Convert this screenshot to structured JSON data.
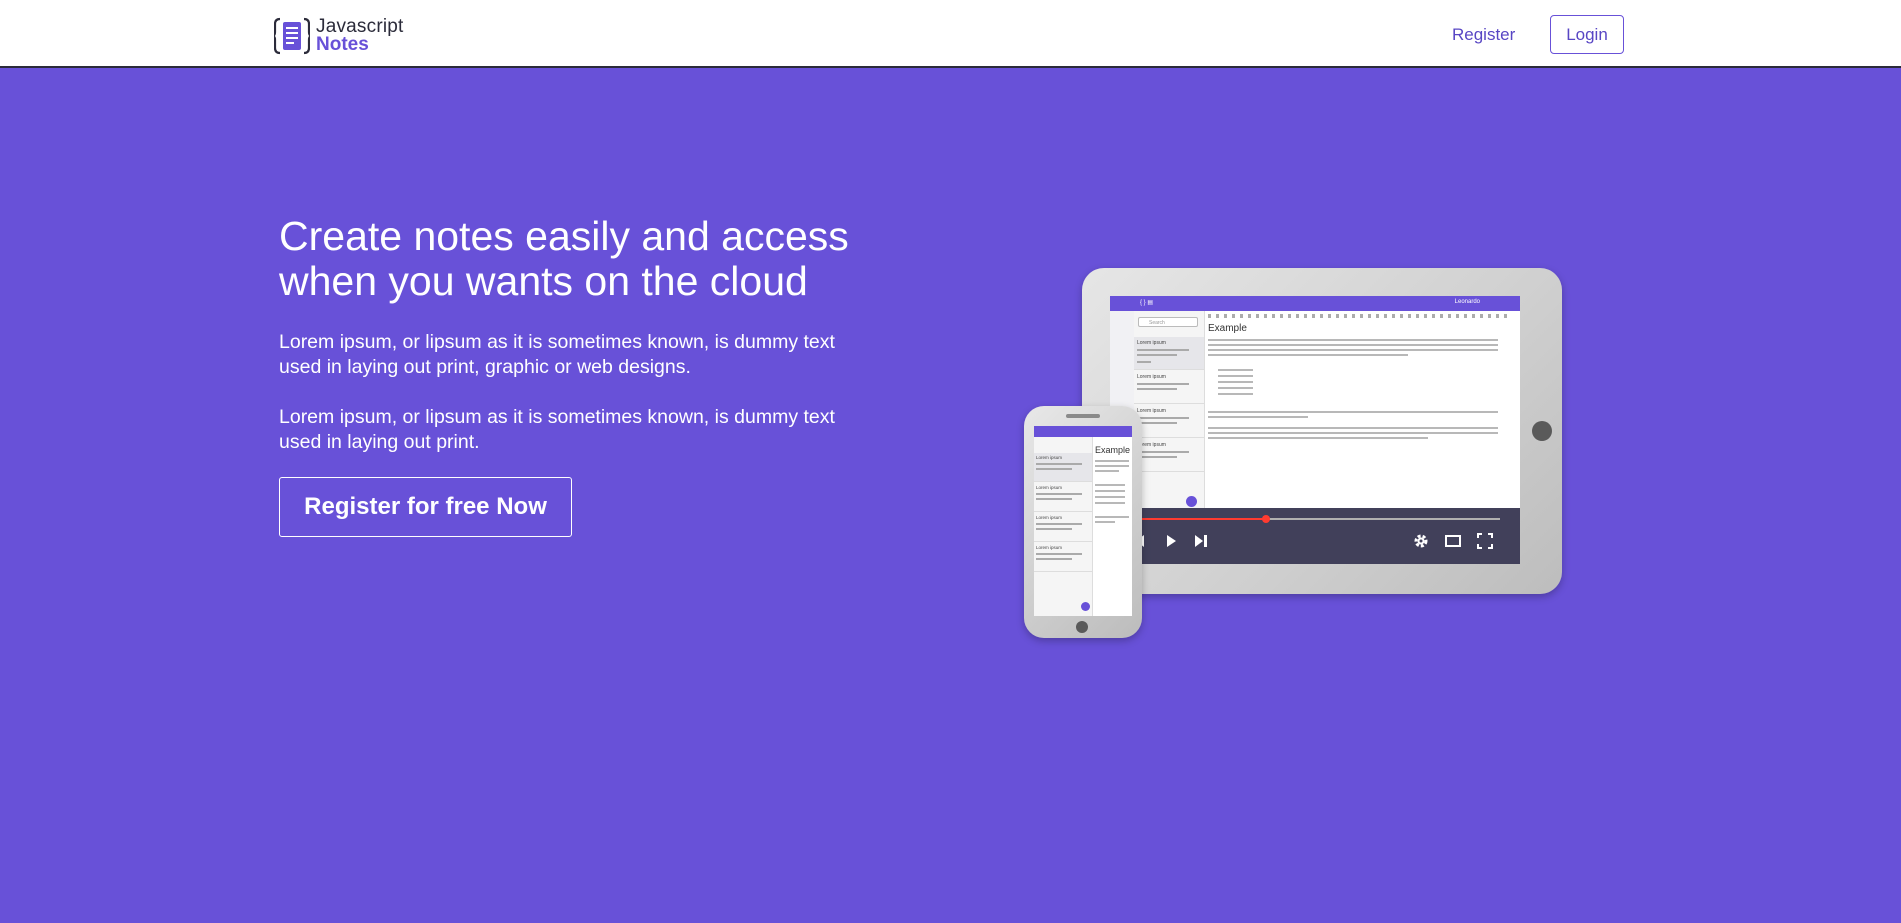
{
  "header": {
    "logo_line1": "Javascript",
    "logo_line2": "Notes",
    "register_label": "Register",
    "login_label": "Login"
  },
  "hero": {
    "title": "Create notes easily and access when you wants on the cloud",
    "paragraph1": "Lorem ipsum, or lipsum as it is sometimes known, is dummy text used in laying out print, graphic or web designs.",
    "paragraph2": "Lorem ipsum, or lipsum as it is sometimes known, is dummy text used in laying out print.",
    "cta_label": "Register for free Now"
  },
  "illustration": {
    "tablet": {
      "search_placeholder": "Search",
      "note_title": "Lorem ipsum",
      "editor_heading": "Example",
      "user_name": "Leonardo",
      "video_progress": 0.35
    },
    "phone": {
      "note_title": "Lorem ipsum",
      "editor_heading": "Example"
    }
  },
  "colors": {
    "brand": "#6851d8",
    "header_bg": "#ffffff",
    "text_on_brand": "#ffffff"
  }
}
